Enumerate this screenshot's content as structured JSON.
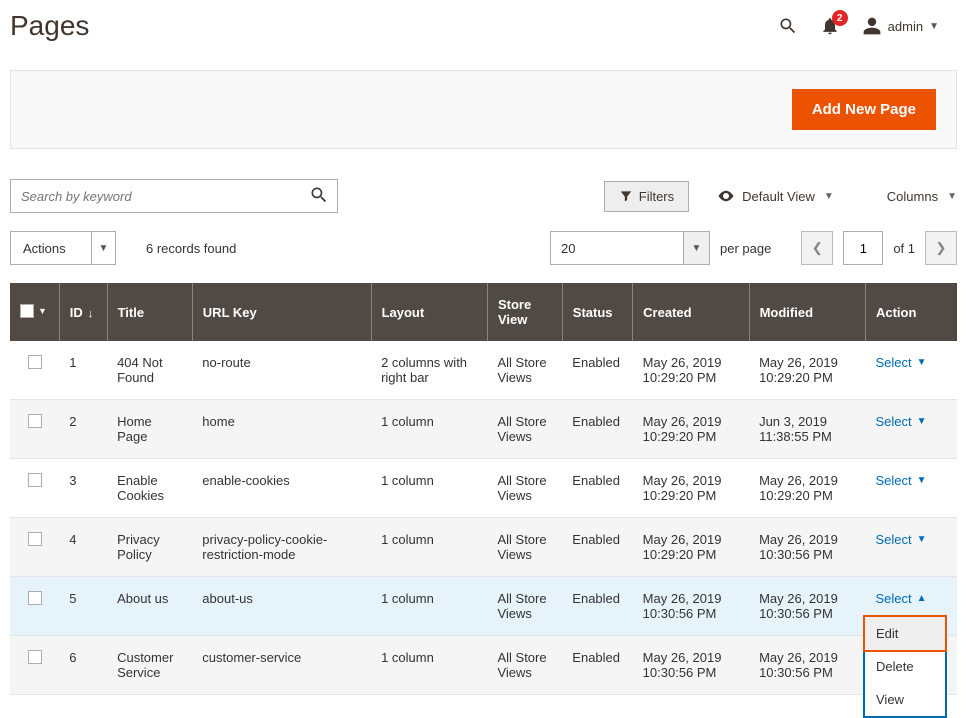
{
  "header": {
    "title": "Pages",
    "notification_count": "2",
    "username": "admin"
  },
  "top_bar": {
    "add_button": "Add New Page"
  },
  "search": {
    "placeholder": "Search by keyword"
  },
  "toolbar": {
    "filters": "Filters",
    "default_view": "Default View",
    "columns": "Columns"
  },
  "actions": {
    "label": "Actions",
    "records_found": "6 records found"
  },
  "pager": {
    "page_size": "20",
    "per_page": "per page",
    "current": "1",
    "of_label": "of 1"
  },
  "columns": {
    "id": "ID",
    "title": "Title",
    "url_key": "URL Key",
    "layout": "Layout",
    "store_view": "Store View",
    "status": "Status",
    "created": "Created",
    "modified": "Modified",
    "action": "Action"
  },
  "action_label": "Select",
  "rows": [
    {
      "id": "1",
      "title": "404 Not Found",
      "url_key": "no-route",
      "layout": "2 columns with right bar",
      "store_view": "All Store Views",
      "status": "Enabled",
      "created": "May 26, 2019 10:29:20 PM",
      "modified": "May 26, 2019 10:29:20 PM"
    },
    {
      "id": "2",
      "title": "Home Page",
      "url_key": "home",
      "layout": "1 column",
      "store_view": "All Store Views",
      "status": "Enabled",
      "created": "May 26, 2019 10:29:20 PM",
      "modified": "Jun 3, 2019 11:38:55 PM"
    },
    {
      "id": "3",
      "title": "Enable Cookies",
      "url_key": "enable-cookies",
      "layout": "1 column",
      "store_view": "All Store Views",
      "status": "Enabled",
      "created": "May 26, 2019 10:29:20 PM",
      "modified": "May 26, 2019 10:29:20 PM"
    },
    {
      "id": "4",
      "title": "Privacy Policy",
      "url_key": "privacy-policy-cookie-restriction-mode",
      "layout": "1 column",
      "store_view": "All Store Views",
      "status": "Enabled",
      "created": "May 26, 2019 10:29:20 PM",
      "modified": "May 26, 2019 10:30:56 PM"
    },
    {
      "id": "5",
      "title": "About us",
      "url_key": "about-us",
      "layout": "1 column",
      "store_view": "All Store Views",
      "status": "Enabled",
      "created": "May 26, 2019 10:30:56 PM",
      "modified": "May 26, 2019 10:30:56 PM"
    },
    {
      "id": "6",
      "title": "Customer Service",
      "url_key": "customer-service",
      "layout": "1 column",
      "store_view": "All Store Views",
      "status": "Enabled",
      "created": "May 26, 2019 10:30:56 PM",
      "modified": "May 26, 2019 10:30:56 PM"
    }
  ],
  "dropdown": {
    "edit": "Edit",
    "delete": "Delete",
    "view": "View"
  }
}
